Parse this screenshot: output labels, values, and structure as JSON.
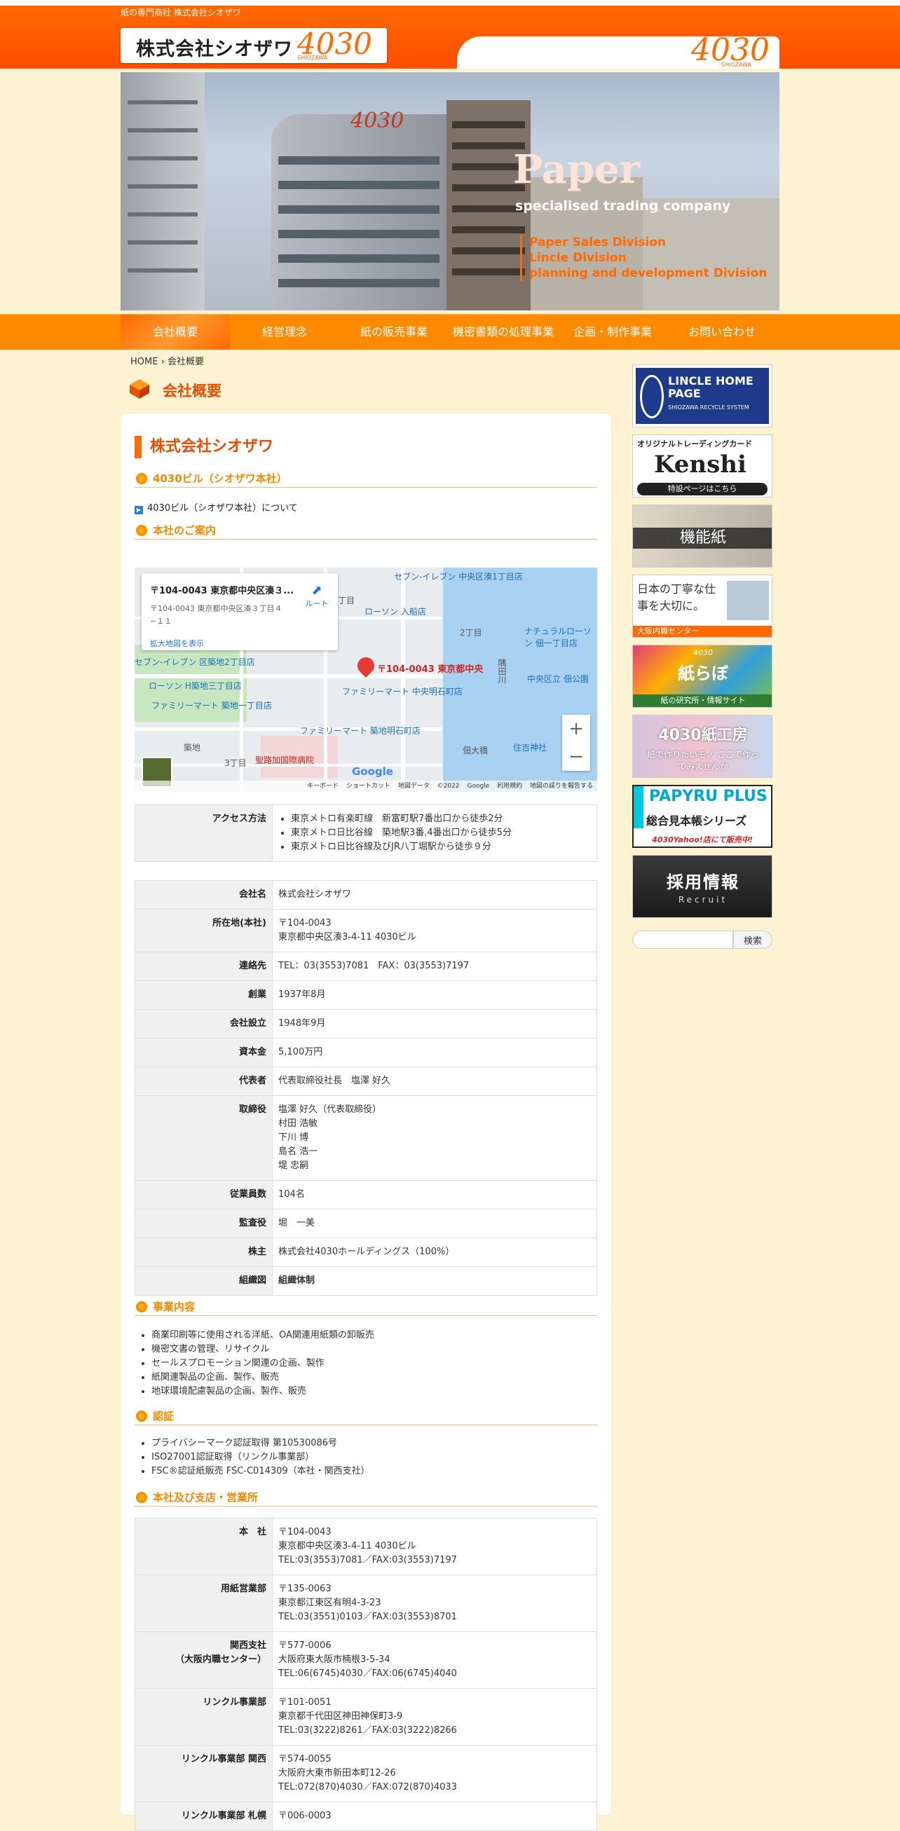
{
  "header": {
    "tagline": "紙の専門商社 株式会社シオザワ",
    "company_name": "株式会社シオザワ",
    "logo_mark": "4030",
    "logo_sub": "SHIOZAWA"
  },
  "hero": {
    "building_sign": "4030",
    "headline": "Paper",
    "subline": "specialised trading company",
    "divisions": [
      "Paper Sales Division",
      "Lincle Division",
      "planning and development Division"
    ]
  },
  "nav": {
    "items": [
      "会社概要",
      "経営理念",
      "紙の販売事業",
      "機密書類の処理事業",
      "企画・制作事業",
      "お問い合わせ"
    ],
    "active_index": 0
  },
  "breadcrumb": {
    "home": "HOME",
    "separator": "›",
    "current": "会社概要"
  },
  "page_title": "会社概要",
  "main": {
    "company_heading": "株式会社シオザワ",
    "section_building": "4030ビル（シオザワ本社）",
    "building_link": "4030ビル（シオザワ本社）について",
    "section_guide": "本社のご案内",
    "map": {
      "card_title": "〒104-0043 東京都中央区湊３...",
      "card_address": "〒104-0043 東京都中央区湊３丁目４−１１",
      "card_route": "ルート",
      "card_enlarge": "拡大地図を表示",
      "pin_label": "〒104-0043 東京都中央",
      "labels": {
        "lawson_iriya": "ローソン 入船店",
        "seven_minato": "セブン-イレブン 中央区湊1丁目店",
        "natural_lawson": "ナチュラルローソン 佃一丁目店",
        "seven_tsukiji": "セブン-イレブン 区築地2丁目店",
        "lawson_h": "ローソン H築地三丁目店",
        "family_tsukiji3": "ファミリーマート 築地一丁目店",
        "family_akashi": "ファミリーマート 中央明石町店",
        "family_akashi2": "ファミリーマート 築地明石町店",
        "hospital": "聖路加国際病院",
        "sumiyoshi": "住吉神社",
        "tsukudaohashi": "佃大橋",
        "river": "隅田川",
        "park": "中央区立 佃公園",
        "chome2": "2丁目",
        "chome3": "3丁目",
        "chome_t": "丁目",
        "tsukiji": "築地"
      },
      "zoom_in": "+",
      "zoom_out": "−",
      "google": "Google",
      "footer": [
        "キーボード ショートカット",
        "地図データ ©2022 Google",
        "利用規約",
        "地図の誤りを報告する"
      ]
    },
    "access": {
      "label": "アクセス方法",
      "items": [
        "東京メトロ有楽町線　新富町駅7番出口から徒歩2分",
        "東京メトロ日比谷線　築地駅3番,4番出口から徒歩5分",
        "東京メトロ日比谷線及びJR八丁堀駅から徒歩９分"
      ]
    },
    "profile": [
      {
        "label": "会社名",
        "lines": [
          "株式会社シオザワ"
        ]
      },
      {
        "label": "所在地(本社)",
        "lines": [
          "〒104-0043",
          "東京都中央区湊3-4-11 4030ビル"
        ]
      },
      {
        "label": "連絡先",
        "lines": [
          "TEL：03(3553)7081　FAX：03(3553)7197"
        ]
      },
      {
        "label": "創業",
        "lines": [
          "1937年8月"
        ]
      },
      {
        "label": "会社設立",
        "lines": [
          "1948年9月"
        ]
      },
      {
        "label": "資本金",
        "lines": [
          "5,100万円"
        ]
      },
      {
        "label": "代表者",
        "lines": [
          "代表取締役社長　塩澤 好久"
        ]
      },
      {
        "label": "取締役",
        "lines": [
          "塩澤 好久（代表取締役）",
          "村田 浩敏",
          "下川 博",
          "島名 浩一",
          "堤 忠嗣"
        ]
      },
      {
        "label": "従業員数",
        "lines": [
          "104名"
        ]
      },
      {
        "label": "監査役",
        "lines": [
          "堀　一美"
        ]
      },
      {
        "label": "株主",
        "lines": [
          "株式会社4030ホールディングス（100%）"
        ]
      },
      {
        "label": "組織図",
        "lines": [
          "組織体制"
        ],
        "bold": true
      }
    ],
    "section_business": "事業内容",
    "business_items": [
      "商業印刷等に使用される洋紙、OA関連用紙類の卸販売",
      "機密文書の管理、リサイクル",
      "セールスプロモーション関連の企画、製作",
      "紙関連製品の企画、製作、販売",
      "地球環境配慮製品の企画、製作、販売"
    ],
    "section_cert": "認証",
    "cert_items": [
      "プライバシーマーク認証取得 第10530086号",
      "ISO27001認証取得（リンクル事業部）",
      "FSC®認証紙販売 FSC-C014309（本社・関西支社）"
    ],
    "section_offices": "本社及び支店・営業所",
    "offices": [
      {
        "label": "本　社",
        "lines": [
          "〒104-0043",
          "東京都中央区湊3-4-11 4030ビル",
          "TEL:03(3553)7081／FAX:03(3553)7197"
        ]
      },
      {
        "label": "用紙営業部",
        "lines": [
          "〒135-0063",
          "東京都江東区有明4-3-23",
          "TEL:03(3551)0103／FAX:03(3553)8701"
        ]
      },
      {
        "label": "関西支社\n（大阪内職センター）",
        "lines": [
          "〒577-0006",
          "大阪府東大阪市楠根3-5-34",
          "TEL:06(6745)4030／FAX:06(6745)4040"
        ]
      },
      {
        "label": "リンクル事業部",
        "lines": [
          "〒101-0051",
          "東京都千代田区神田神保町3-9",
          "TEL:03(3222)8261／FAX:03(3222)8266"
        ]
      },
      {
        "label": "リンクル事業部 関西",
        "lines": [
          "〒574-0055",
          "大阪府大東市新田本町12-26",
          "TEL:072(870)4030／FAX:072(870)4033"
        ]
      },
      {
        "label": "リンクル事業部 札幌",
        "lines": [
          "〒006-0003"
        ]
      }
    ]
  },
  "sidebar": {
    "banners": [
      {
        "title": "LINCLE HOME PAGE",
        "sub": "SHIOZAWA RECYCLE SYSTEM"
      },
      {
        "title": "オリジナルトレーディングカード",
        "main": "Kenshi",
        "sub": "特設ページはこちら"
      },
      {
        "title": "機能紙"
      },
      {
        "title": "日本の丁寧な仕事を大切に。",
        "sub": "大阪内職センター"
      },
      {
        "title": "4030",
        "main": "紙らぼ",
        "sub": "紙の研究所・情報サイト"
      },
      {
        "title": "4030紙工房",
        "sub": "紙で作りたいモノ ここで作ってみませんか"
      },
      {
        "title": "PAPYRU PLUS",
        "main": "総合見本帳シリーズ",
        "sub": "4030Yahoo!店にて販売中!"
      },
      {
        "title": "採用情報",
        "sub": "Recruit"
      }
    ],
    "search_button": "検索",
    "search_placeholder": ""
  },
  "colors": {
    "brand_orange": "#ff6a00",
    "nav_orange": "#ff8a00",
    "background": "#fdf3d3"
  }
}
